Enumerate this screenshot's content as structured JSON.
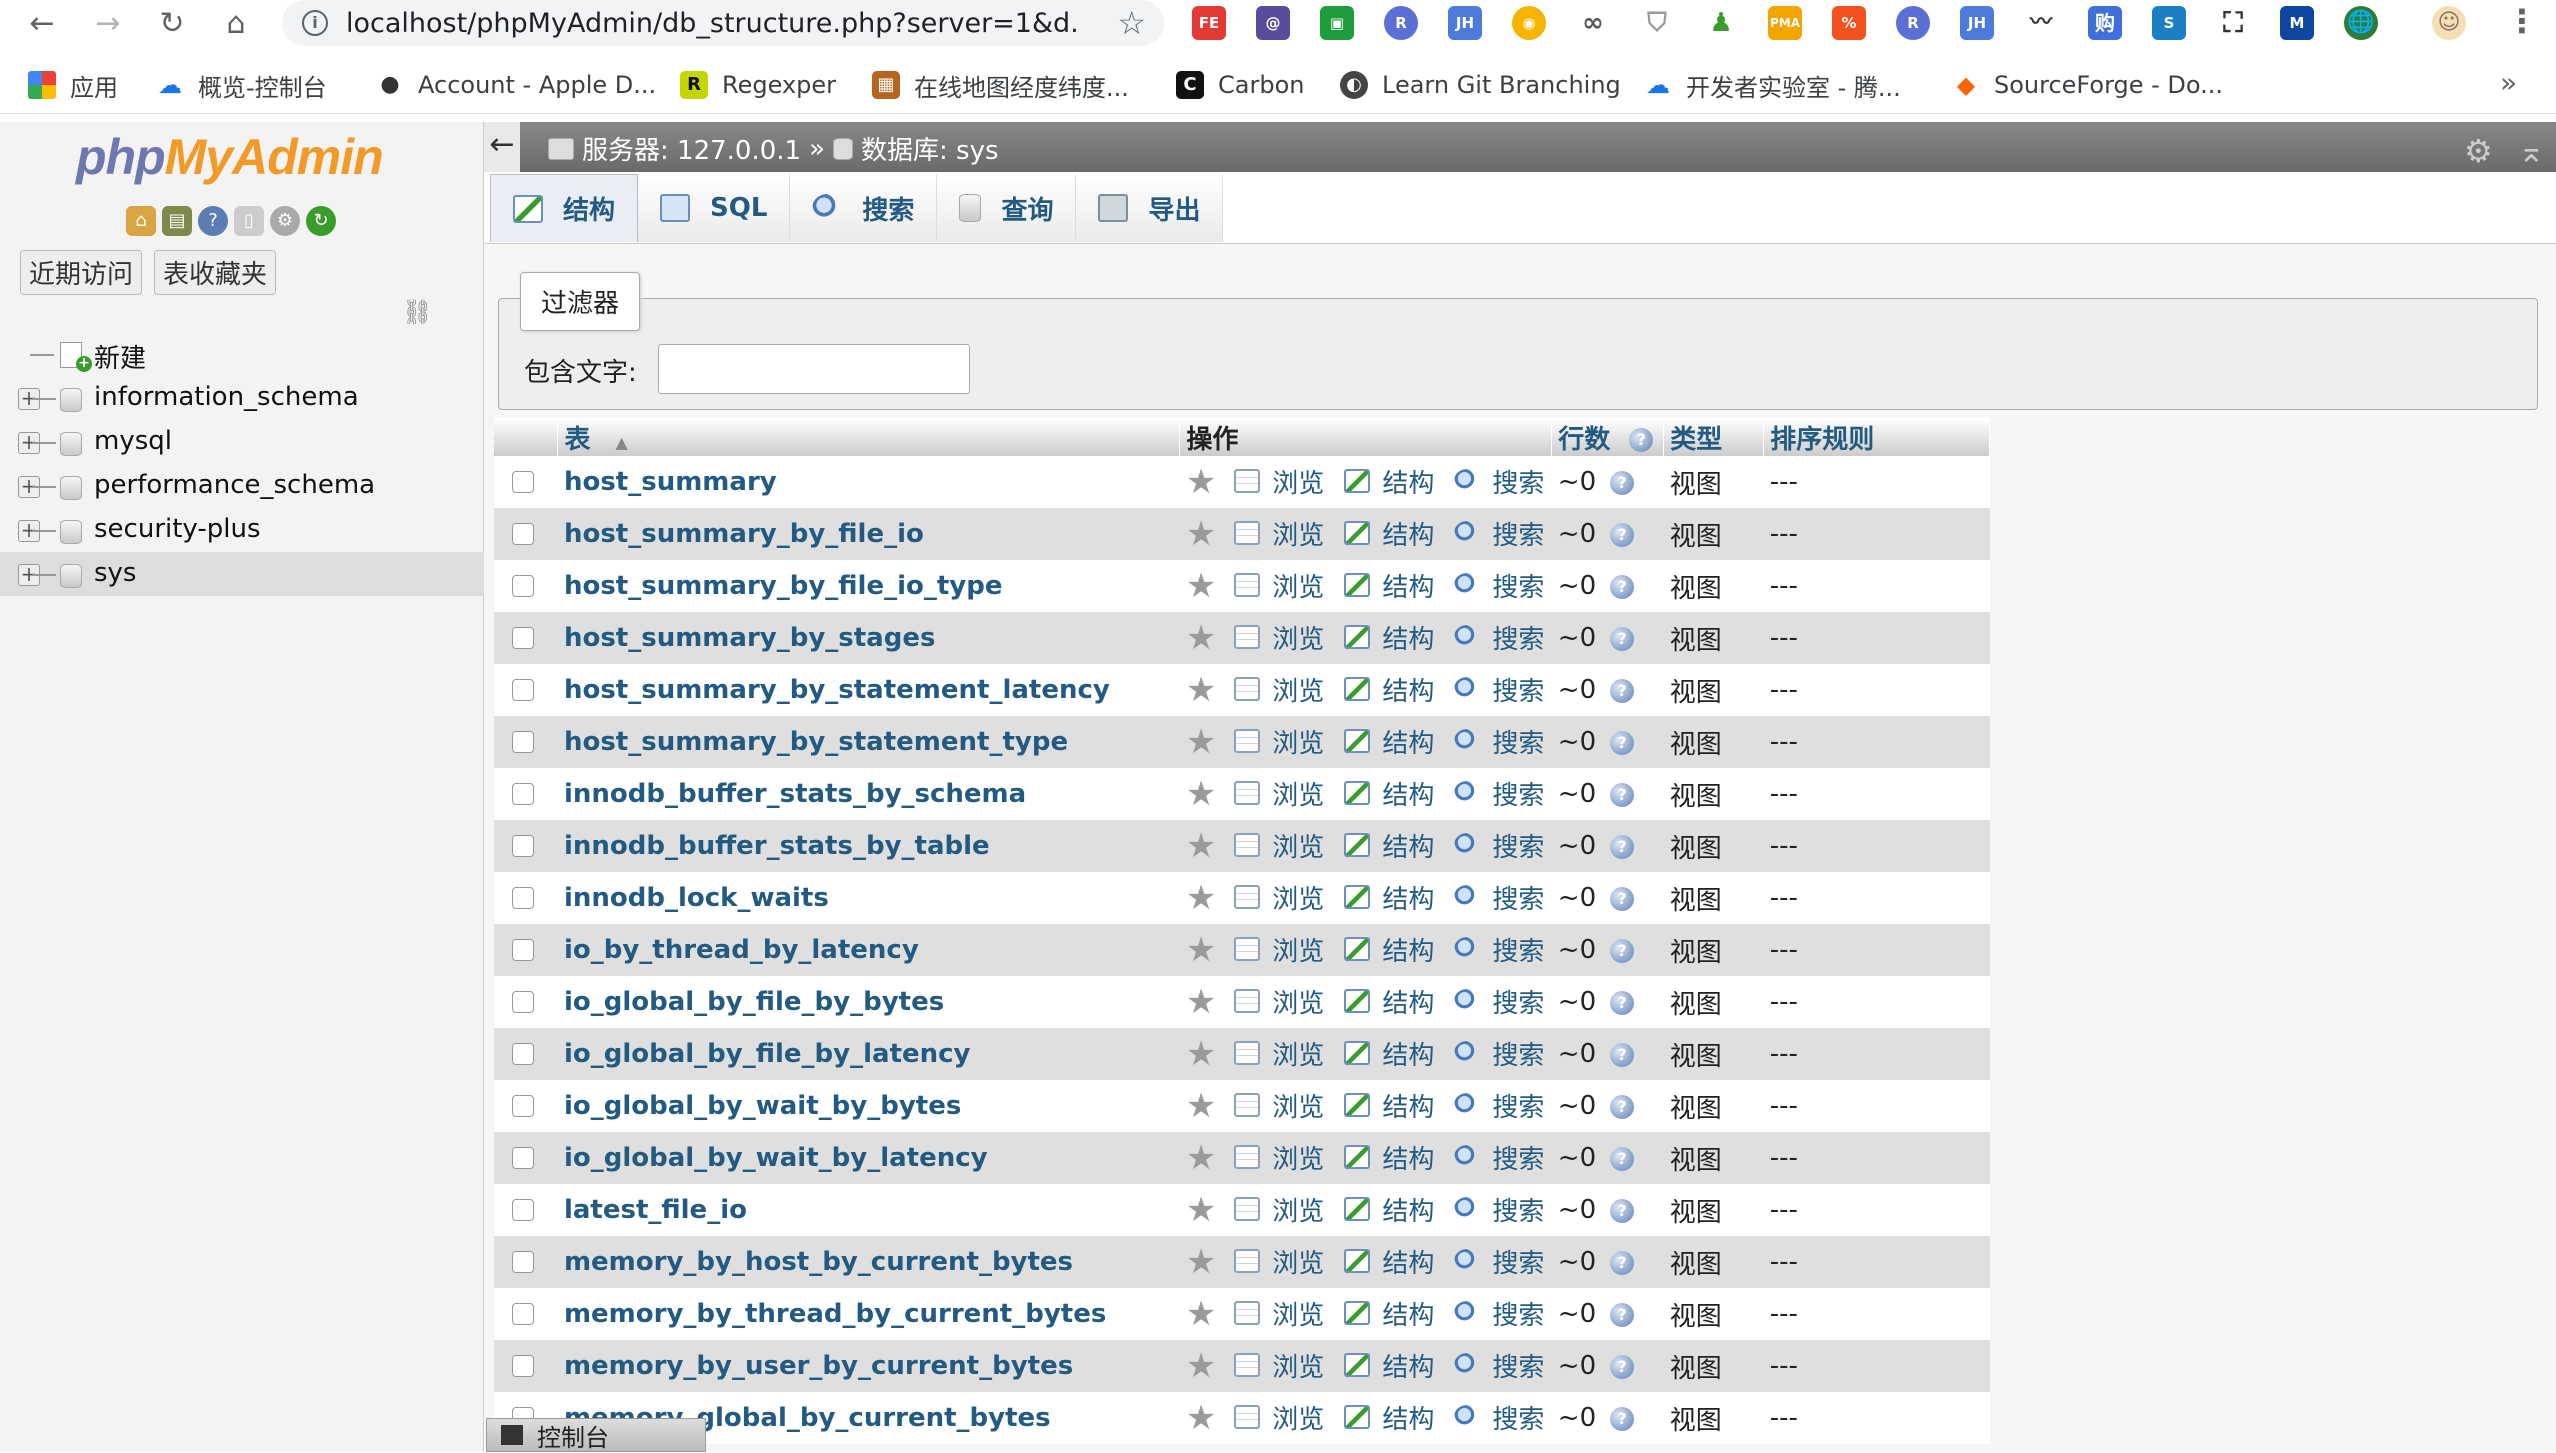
{
  "browser": {
    "url": "localhost/phpMyAdmin/db_structure.php?server=1&d...",
    "bookmarks": [
      {
        "label": "应用",
        "icon": "apps-grid-icon",
        "color": "#ea4335"
      },
      {
        "label": "概览-控制台",
        "icon": "cloud-icon",
        "color": "#1a73e8"
      },
      {
        "label": "Account - Apple D...",
        "icon": "apple-icon",
        "color": "#333333"
      },
      {
        "label": "Regexper",
        "icon": "regexper-icon",
        "color": "#222222"
      },
      {
        "label": "在线地图经度纬度...",
        "icon": "map-icon",
        "color": "#b5651d"
      },
      {
        "label": "Carbon",
        "icon": "carbon-icon",
        "color": "#111111"
      },
      {
        "label": "Learn Git Branching",
        "icon": "git-icon",
        "color": "#333333"
      },
      {
        "label": "开发者实验室 - 腾...",
        "icon": "cloud-icon",
        "color": "#1a73e8"
      },
      {
        "label": "SourceForge - Do...",
        "icon": "sourceforge-icon",
        "color": "#ff6600"
      }
    ]
  },
  "sidebar": {
    "logo_php": "php",
    "logo_myadmin": "MyAdmin",
    "tabs": [
      "近期访问",
      "表收藏夹"
    ],
    "tree": [
      {
        "label": "新建",
        "type": "new"
      },
      {
        "label": "information_schema",
        "type": "db"
      },
      {
        "label": "mysql",
        "type": "db"
      },
      {
        "label": "performance_schema",
        "type": "db"
      },
      {
        "label": "security-plus",
        "type": "db"
      },
      {
        "label": "sys",
        "type": "db",
        "active": true
      }
    ]
  },
  "topbar": {
    "server": "服务器: 127.0.0.1",
    "separator": "»",
    "database": "数据库: sys"
  },
  "tabs": [
    "结构",
    "SQL",
    "搜索",
    "查询",
    "导出"
  ],
  "filter": {
    "legend": "过滤器",
    "label": "包含文字:",
    "value": ""
  },
  "table": {
    "headers": {
      "table": "表",
      "ops": "操作",
      "rows": "行数",
      "type": "类型",
      "collation": "排序规则"
    },
    "actions": {
      "browse": "浏览",
      "structure": "结构",
      "search": "搜索"
    },
    "rows": [
      {
        "name": "host_summary",
        "rows": "~0",
        "type": "视图",
        "collation": "---"
      },
      {
        "name": "host_summary_by_file_io",
        "rows": "~0",
        "type": "视图",
        "collation": "---"
      },
      {
        "name": "host_summary_by_file_io_type",
        "rows": "~0",
        "type": "视图",
        "collation": "---"
      },
      {
        "name": "host_summary_by_stages",
        "rows": "~0",
        "type": "视图",
        "collation": "---"
      },
      {
        "name": "host_summary_by_statement_latency",
        "rows": "~0",
        "type": "视图",
        "collation": "---"
      },
      {
        "name": "host_summary_by_statement_type",
        "rows": "~0",
        "type": "视图",
        "collation": "---"
      },
      {
        "name": "innodb_buffer_stats_by_schema",
        "rows": "~0",
        "type": "视图",
        "collation": "---"
      },
      {
        "name": "innodb_buffer_stats_by_table",
        "rows": "~0",
        "type": "视图",
        "collation": "---"
      },
      {
        "name": "innodb_lock_waits",
        "rows": "~0",
        "type": "视图",
        "collation": "---"
      },
      {
        "name": "io_by_thread_by_latency",
        "rows": "~0",
        "type": "视图",
        "collation": "---"
      },
      {
        "name": "io_global_by_file_by_bytes",
        "rows": "~0",
        "type": "视图",
        "collation": "---"
      },
      {
        "name": "io_global_by_file_by_latency",
        "rows": "~0",
        "type": "视图",
        "collation": "---"
      },
      {
        "name": "io_global_by_wait_by_bytes",
        "rows": "~0",
        "type": "视图",
        "collation": "---"
      },
      {
        "name": "io_global_by_wait_by_latency",
        "rows": "~0",
        "type": "视图",
        "collation": "---"
      },
      {
        "name": "latest_file_io",
        "rows": "~0",
        "type": "视图",
        "collation": "---"
      },
      {
        "name": "memory_by_host_by_current_bytes",
        "rows": "~0",
        "type": "视图",
        "collation": "---"
      },
      {
        "name": "memory_by_thread_by_current_bytes",
        "rows": "~0",
        "type": "视图",
        "collation": "---"
      },
      {
        "name": "memory_by_user_by_current_bytes",
        "rows": "~0",
        "type": "视图",
        "collation": "---"
      },
      {
        "name": "memory_global_by_current_bytes",
        "rows": "~0",
        "type": "视图",
        "collation": "---"
      }
    ]
  },
  "console": {
    "label": "控制台"
  }
}
